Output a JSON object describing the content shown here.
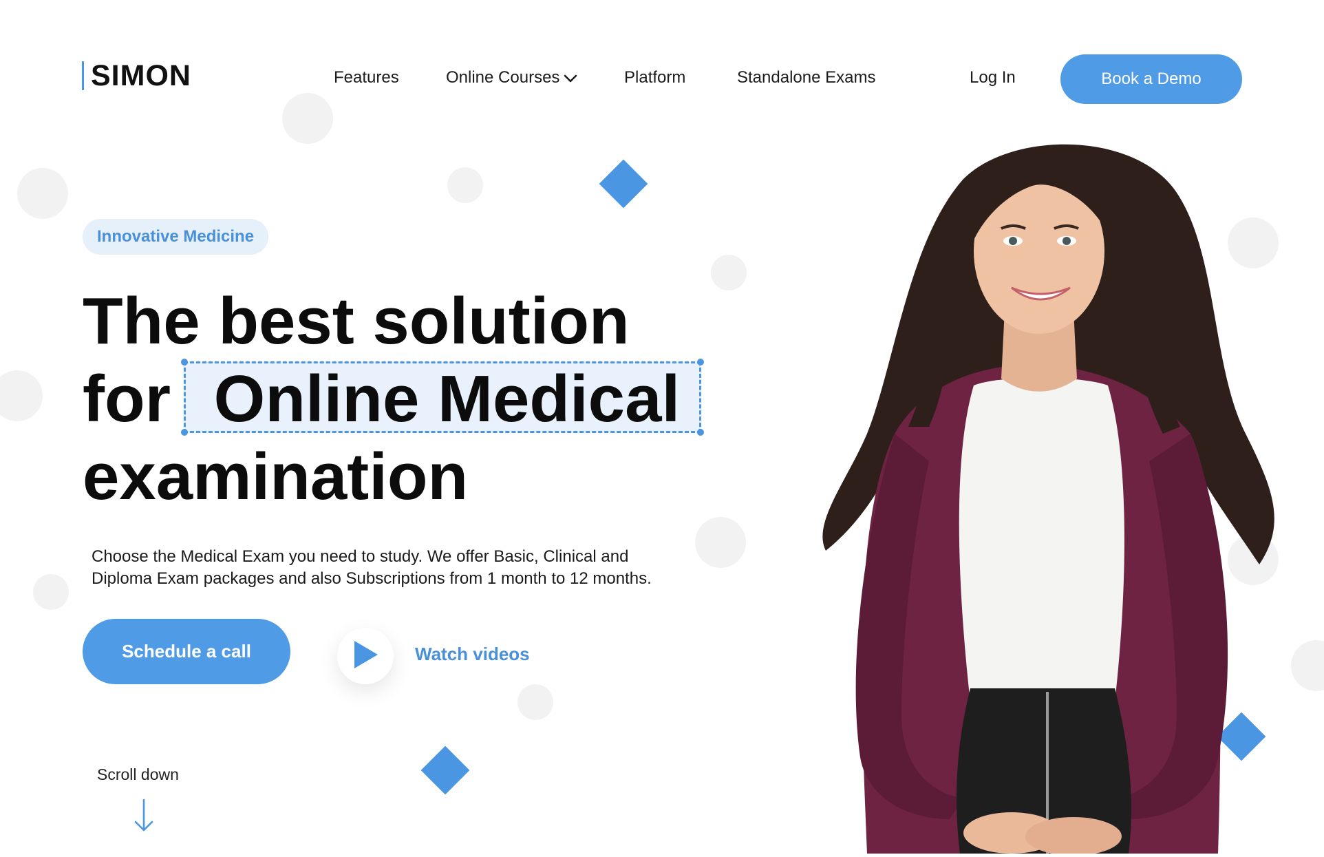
{
  "brand": {
    "name": "SIMON",
    "accent": "#4a96e2"
  },
  "nav": {
    "items": [
      "Features",
      "Online Courses",
      "Platform",
      "Standalone Exams"
    ],
    "login": "Log In",
    "cta": "Book a Demo"
  },
  "hero": {
    "tag": "Innovative Medicine",
    "headline_line1": "The best solution",
    "headline_for": "for",
    "headline_highlight": "Online Medical",
    "headline_line3": "examination",
    "description_line1": "Choose the Medical Exam you need to study. We offer Basic, Clinical and",
    "description_line2": "Diploma Exam packages and also Subscriptions from 1 month to 12 months.",
    "primary_cta": "Schedule a call",
    "secondary_cta": "Watch videos",
    "scroll_hint": "Scroll down"
  },
  "icons": [
    "play-icon",
    "chevron-down-icon",
    "arrow-down-icon"
  ]
}
